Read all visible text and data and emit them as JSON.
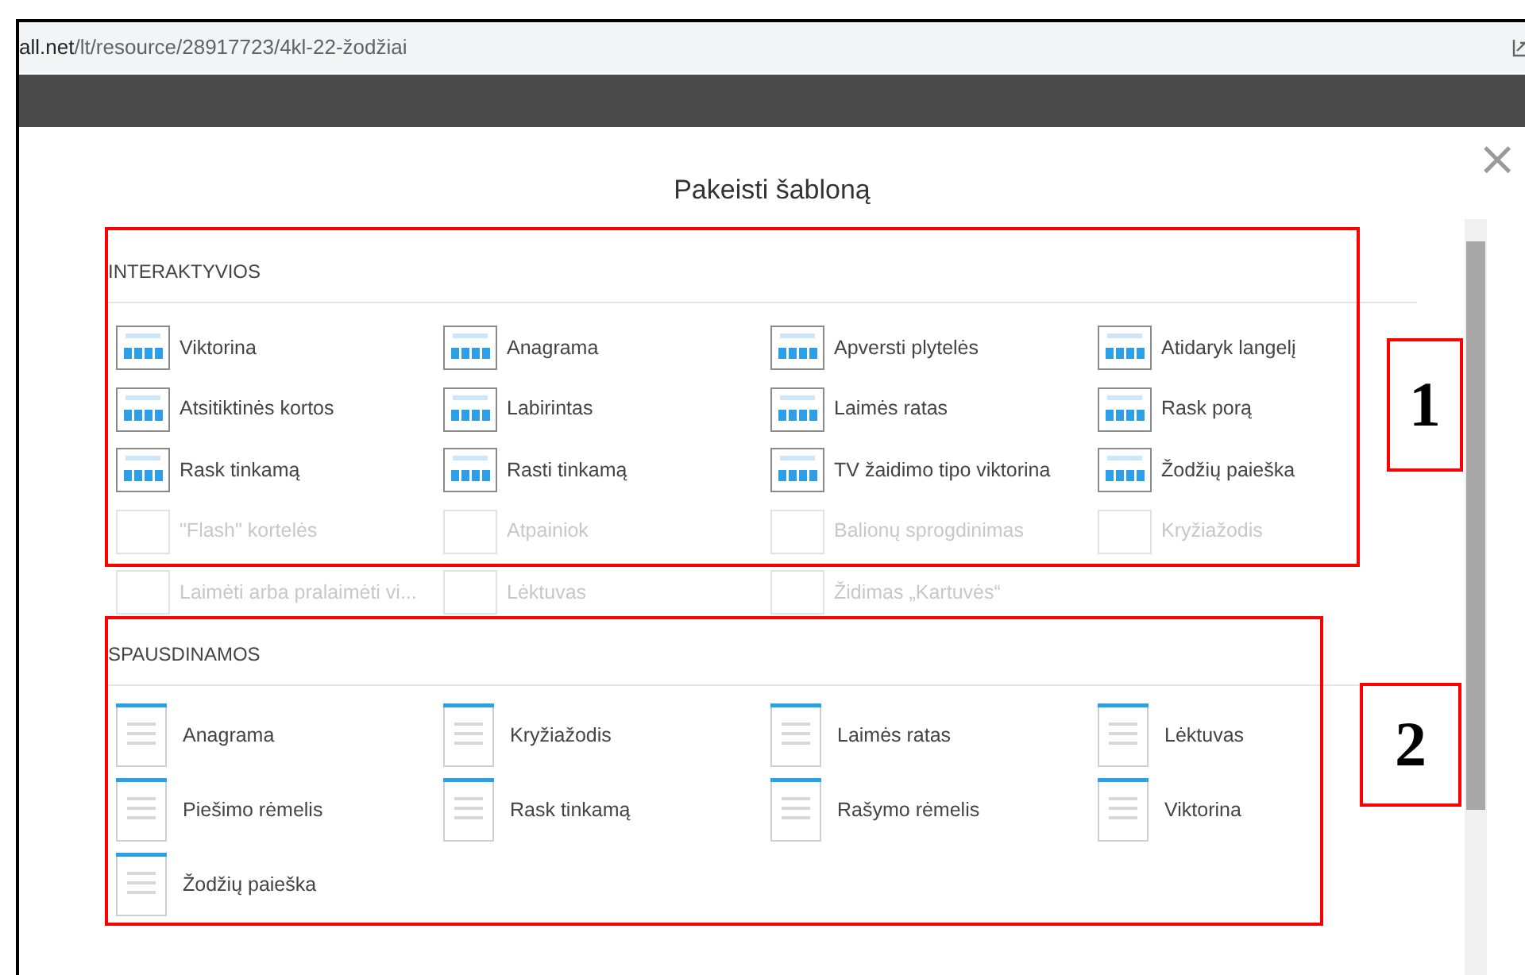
{
  "address_bar": {
    "host": "all.net",
    "path": "/lt/resource/28917723/4kl-22-žodžiai"
  },
  "dialog": {
    "title": "Pakeisti šabloną",
    "close": "×"
  },
  "sections": [
    {
      "title": "INTERAKTYVIOS",
      "kind": "interactive",
      "items": [
        {
          "label": "Viktorina",
          "disabled": false
        },
        {
          "label": "Anagrama",
          "disabled": false
        },
        {
          "label": "Apversti plytelės",
          "disabled": false
        },
        {
          "label": "Atidaryk langelį",
          "disabled": false
        },
        {
          "label": "Atsitiktinės kortos",
          "disabled": false
        },
        {
          "label": "Labirintas",
          "disabled": false
        },
        {
          "label": "Laimės ratas",
          "disabled": false
        },
        {
          "label": "Rask porą",
          "disabled": false
        },
        {
          "label": "Rask tinkamą",
          "disabled": false
        },
        {
          "label": "Rasti tinkamą",
          "disabled": false
        },
        {
          "label": "TV žaidimo tipo viktorina",
          "disabled": false
        },
        {
          "label": "Žodžių paieška",
          "disabled": false
        },
        {
          "label": "\"Flash\" kortelės",
          "disabled": true
        },
        {
          "label": "Atpainiok",
          "disabled": true
        },
        {
          "label": "Balionų sprogdinimas",
          "disabled": true
        },
        {
          "label": "Kryžiažodis",
          "disabled": true
        },
        {
          "label": "Laimėti arba pralaimėti vi...",
          "disabled": true
        },
        {
          "label": "Lėktuvas",
          "disabled": true
        },
        {
          "label": "Židimas „Kartuvės“",
          "disabled": true
        }
      ]
    },
    {
      "title": "SPAUSDINAMOS",
      "kind": "printable",
      "items": [
        {
          "label": "Anagrama"
        },
        {
          "label": "Kryžiažodis"
        },
        {
          "label": "Laimės ratas"
        },
        {
          "label": "Lėktuvas"
        },
        {
          "label": "Piešimo rėmelis"
        },
        {
          "label": "Rask tinkamą"
        },
        {
          "label": "Rašymo rėmelis"
        },
        {
          "label": "Viktorina"
        },
        {
          "label": "Žodžių paieška"
        }
      ]
    }
  ],
  "annotations": [
    {
      "number": "1"
    },
    {
      "number": "2"
    }
  ]
}
